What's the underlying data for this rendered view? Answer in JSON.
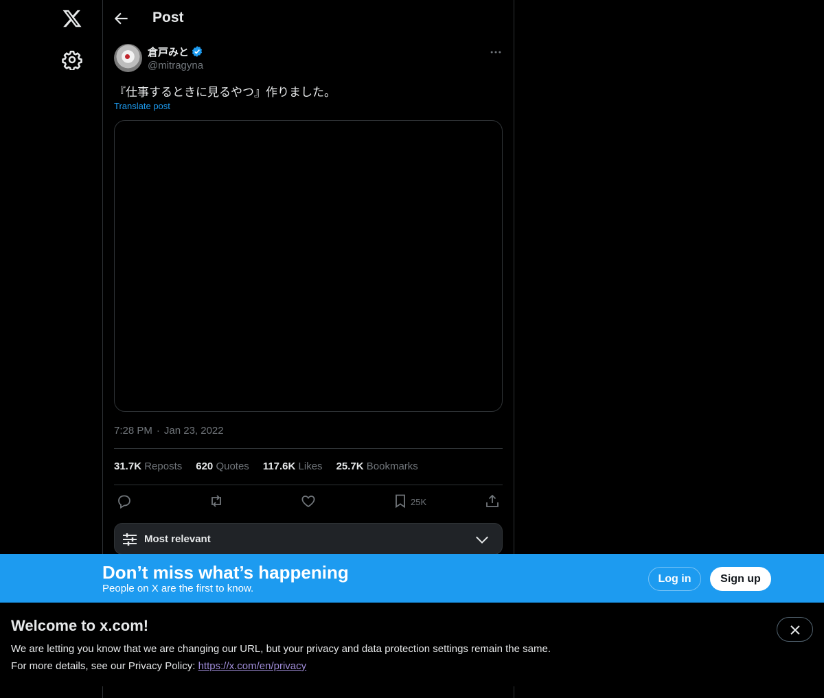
{
  "header": {
    "title": "Post"
  },
  "post": {
    "author_name": "倉戸みと",
    "author_handle": "@mitragyna",
    "text": "『仕事するときに見るやつ』作りました。",
    "translate_label": "Translate post",
    "time": "7:28 PM",
    "separator": "·",
    "date": "Jan 23, 2022",
    "stats": [
      {
        "value": "31.7K",
        "label": "Reposts"
      },
      {
        "value": "620",
        "label": "Quotes"
      },
      {
        "value": "117.6K",
        "label": "Likes"
      },
      {
        "value": "25.7K",
        "label": "Bookmarks"
      }
    ],
    "bookmark_count": "25K"
  },
  "replies": {
    "sort_label": "Most relevant"
  },
  "banner": {
    "title": "Don’t miss what’s happening",
    "subtitle": "People on X are the first to know.",
    "login_label": "Log in",
    "signup_label": "Sign up"
  },
  "welcome": {
    "title": "Welcome to x.com!",
    "line1": "We are letting you know that we are changing our URL, but your privacy and data protection settings remain the same.",
    "line2_prefix": "For more details, see our Privacy Policy: ",
    "link": "https://x.com/en/privacy"
  },
  "colors": {
    "accent": "#1d9bf0",
    "background": "#000000",
    "muted": "#71767b",
    "link_visited": "#a08dd9"
  },
  "icons": [
    "x-logo-icon",
    "settings-icon",
    "back-arrow-icon",
    "verified-badge-icon",
    "more-icon",
    "reply-icon",
    "repost-icon",
    "like-icon",
    "bookmark-icon",
    "share-icon",
    "filter-icon",
    "chevron-down-icon",
    "close-icon"
  ]
}
